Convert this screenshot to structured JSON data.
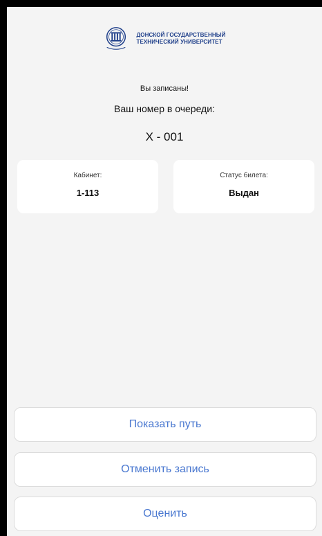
{
  "header": {
    "university_line1": "ДОНСКОЙ ГОСУДАРСТВЕННЫЙ",
    "university_line2": "ТЕХНИЧЕСКИЙ УНИВЕРСИТЕТ",
    "logo_icon": "dstu-logo-icon",
    "brand_color": "#1f3f8a"
  },
  "status": {
    "message": "Вы записаны!",
    "queue_label": "Ваш номер в очереди:",
    "queue_number": "X - 001"
  },
  "cards": {
    "cabinet_label": "Кабинет:",
    "cabinet_value": "1-113",
    "ticket_status_label": "Статус билета:",
    "ticket_status_value": "Выдан"
  },
  "actions": {
    "show_path": "Показать путь",
    "cancel": "Отменить запись",
    "rate": "Оценить",
    "accent_color": "#4a78d0"
  }
}
